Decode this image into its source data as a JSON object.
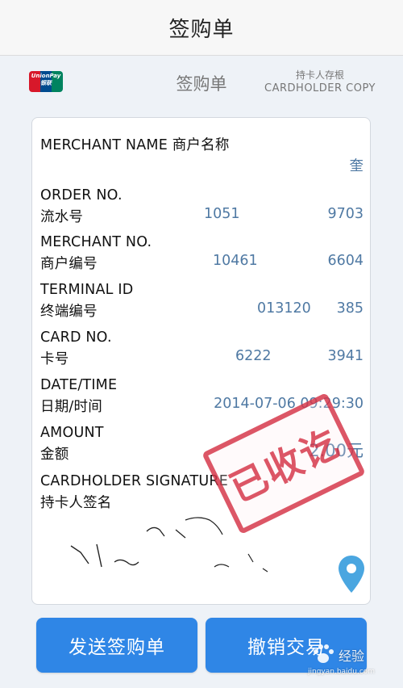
{
  "topbar": {
    "title": "签购单"
  },
  "header": {
    "logo_text": "UnionPay 银联",
    "title": "签购单",
    "copy_cn": "持卡人存根",
    "copy_en": "CARDHOLDER COPY"
  },
  "receipt": {
    "merchant_name_label": "MERCHANT NAME 商户名称",
    "merchant_name_value": "奎",
    "order_label_en": "ORDER NO.",
    "order_label_cn": "流水号",
    "order_value_a": "1051",
    "order_value_b": "9703",
    "merchant_no_label_en": "MERCHANT NO.",
    "merchant_no_label_cn": "商户编号",
    "merchant_no_value_a": "10461",
    "merchant_no_value_b": "6604",
    "terminal_label_en": "TERMINAL ID",
    "terminal_label_cn": "终端编号",
    "terminal_value_a": "013120",
    "terminal_value_b": "385",
    "card_label_en": "CARD NO.",
    "card_label_cn": "卡号",
    "card_value_a": "6222",
    "card_value_b": "3941",
    "datetime_label_en": "DATE/TIME",
    "datetime_label_cn": "日期/时间",
    "datetime_value": "2014-07-06 09:29:30",
    "amount_label_en": "AMOUNT",
    "amount_label_cn": "金额",
    "amount_value": "2.00元",
    "signature_label_en": "CARDHOLDER SIGNATURE",
    "signature_label_cn": "持卡人签名",
    "stamp_text": "已收讫"
  },
  "buttons": {
    "send_label": "发送签购单",
    "cancel_label": "撤销交易"
  },
  "watermark": {
    "text": "经验",
    "url": "jingyan.baidu.com"
  },
  "colors": {
    "accent": "#2f86e6",
    "value_text": "#4f79a3",
    "stamp": "#d2283c"
  }
}
